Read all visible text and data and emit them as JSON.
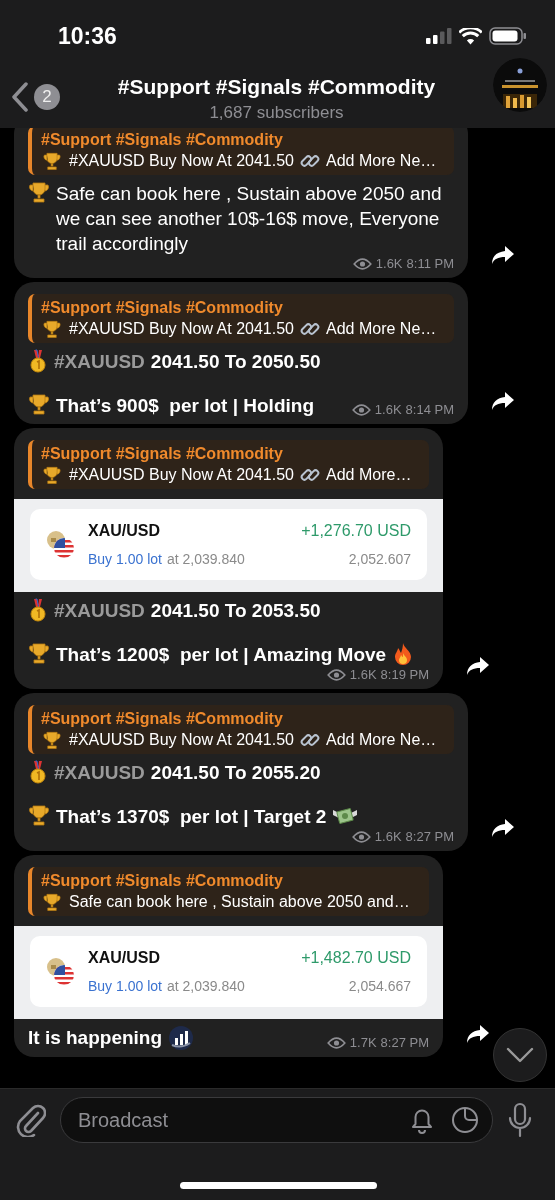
{
  "status_bar": {
    "time": "10:36"
  },
  "header": {
    "back_badge": "2",
    "title": "#Support #Signals #Commodity",
    "subtitle": "1,687 subscribers"
  },
  "messages": [
    {
      "reply": {
        "author": "#Support #Signals #Commodity",
        "text": "#XAUUSD Buy Now At 2041.50",
        "link_text": "Add More Ne…"
      },
      "lines": [
        {
          "kind": "note",
          "text": "Safe can book here , Sustain above 2050 and we can see another 10$-16$ move, Everyone trail accordingly"
        }
      ],
      "views": "1.6K",
      "time": "8:11 PM"
    },
    {
      "reply": {
        "author": "#Support #Signals #Commodity",
        "text": "#XAUUSD Buy Now At 2041.50",
        "link_text": "Add More Ne…"
      },
      "lines": [
        {
          "kind": "range",
          "tag": "#XAUUSD",
          "text": "2041.50 To 2050.50"
        },
        {
          "kind": "profit",
          "text": "That’s 900$  per lot | Holding"
        }
      ],
      "views": "1.6K",
      "time": "8:14 PM"
    },
    {
      "reply": {
        "author": "#Support #Signals #Commodity",
        "text": "#XAUUSD Buy Now At 2041.50",
        "link_text": "Add More…"
      },
      "trade": {
        "symbol": "XAU/USD",
        "profit": "+1,276.70 USD",
        "order": "Buy 1.00 lot",
        "open": "at 2,039.840",
        "current": "2,052.607"
      },
      "lines": [
        {
          "kind": "range",
          "tag": "#XAUUSD",
          "text": "2041.50 To 2053.50"
        },
        {
          "kind": "profit",
          "text": "That’s 1200$  per lot | Amazing Move"
        }
      ],
      "views": "1.6K",
      "time": "8:19 PM"
    },
    {
      "reply": {
        "author": "#Support #Signals #Commodity",
        "text": "#XAUUSD Buy Now At 2041.50",
        "link_text": "Add More Ne…"
      },
      "lines": [
        {
          "kind": "range",
          "tag": "#XAUUSD",
          "text": "2041.50 To 2055.20"
        },
        {
          "kind": "profit",
          "text": "That’s 1370$  per lot | Target 2"
        }
      ],
      "views": "1.6K",
      "time": "8:27 PM"
    },
    {
      "reply": {
        "author": "#Support #Signals #Commodity",
        "text": "Safe can book here , Sustain above 2050 and…"
      },
      "trade": {
        "symbol": "XAU/USD",
        "profit": "+1,482.70 USD",
        "order": "Buy 1.00 lot",
        "open": "at 2,039.840",
        "current": "2,054.667"
      },
      "lines": [
        {
          "kind": "status",
          "text": "It is happening"
        }
      ],
      "views": "1.7K",
      "time": "8:27 PM"
    }
  ],
  "composer": {
    "placeholder": "Broadcast"
  }
}
